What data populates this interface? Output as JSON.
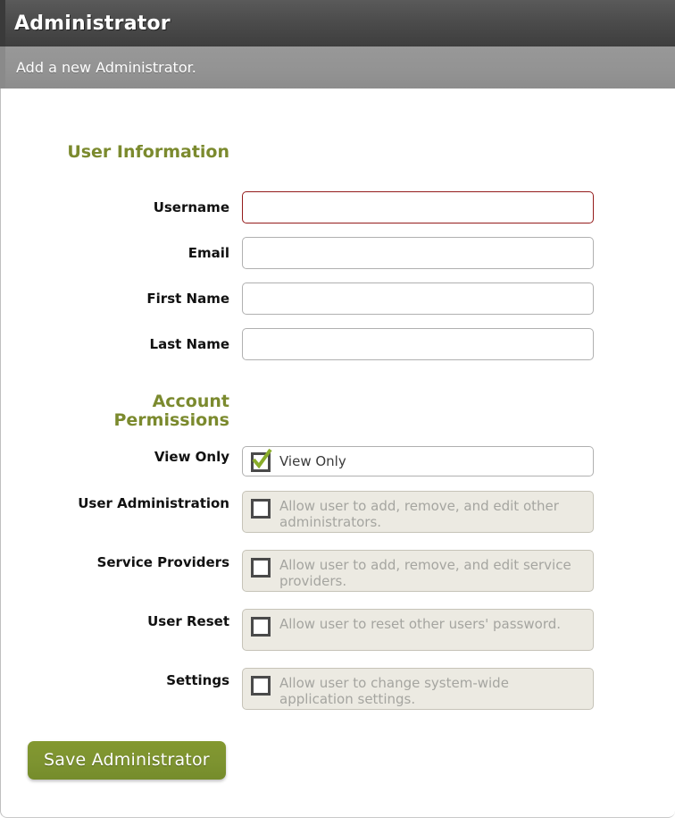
{
  "header": {
    "title": "Administrator",
    "subtitle": "Add a new Administrator."
  },
  "colors": {
    "heading_olive": "#7b8a2e",
    "save_button_green": "#7d9330",
    "error_border_red": "#941b1b",
    "titlebar_dark": "#4c4c4c",
    "subtitlebar_gray": "#939393",
    "disabled_row_bg": "#eceae2",
    "check_green": "#8aad2a"
  },
  "sections": {
    "user_information": {
      "heading": "User Information",
      "fields": [
        {
          "label": "Username",
          "value": "",
          "placeholder": "",
          "error": true
        },
        {
          "label": "Email",
          "value": "",
          "placeholder": "",
          "error": false
        },
        {
          "label": "First Name",
          "value": "",
          "placeholder": "",
          "error": false
        },
        {
          "label": "Last Name",
          "value": "",
          "placeholder": "",
          "error": false
        }
      ]
    },
    "account_permissions": {
      "heading": "Account Permissions",
      "heading_line1": "Account",
      "heading_line2": "Permissions",
      "rows": [
        {
          "label": "View Only",
          "description": "View Only",
          "checked": true,
          "disabled": false
        },
        {
          "label": "User Administration",
          "description": "Allow user to add, remove, and edit other administrators.",
          "checked": false,
          "disabled": true
        },
        {
          "label": "Service Providers",
          "description": "Allow user to add, remove, and edit service providers.",
          "checked": false,
          "disabled": true
        },
        {
          "label": "User Reset",
          "description": "Allow user to reset other users' password.",
          "checked": false,
          "disabled": true
        },
        {
          "label": "Settings",
          "description": "Allow user to change system-wide application settings.",
          "checked": false,
          "disabled": true
        }
      ]
    }
  },
  "footer": {
    "save_label": "Save Administrator"
  }
}
